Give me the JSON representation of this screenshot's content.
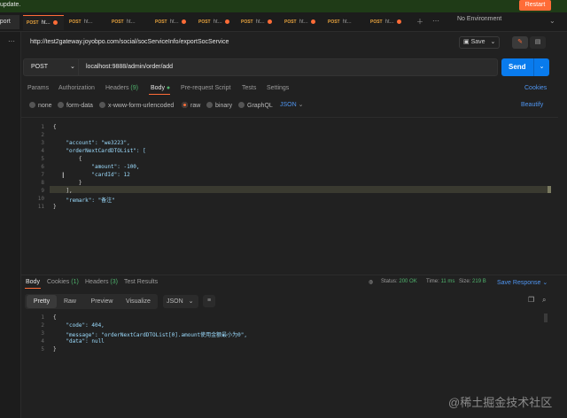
{
  "banner": {
    "text": "update.",
    "restart": "Restart"
  },
  "tabs": [
    {
      "method": "POST",
      "name": "ht...",
      "dot": true
    },
    {
      "method": "POST",
      "name": "ht...",
      "dot": false
    },
    {
      "method": "POST",
      "name": "ht...",
      "dot": false
    },
    {
      "method": "POST",
      "name": "ht...",
      "dot": true
    },
    {
      "method": "POST",
      "name": "ht...",
      "dot": true
    },
    {
      "method": "POST",
      "name": "ht...",
      "dot": true
    },
    {
      "method": "POST",
      "name": "ht...",
      "dot": true
    },
    {
      "method": "POST",
      "name": "ht...",
      "dot": false
    },
    {
      "method": "POST",
      "name": "ht...",
      "dot": true
    }
  ],
  "toolbar": {
    "import": "Import",
    "env": "No Environment"
  },
  "request": {
    "title_url": "http://test2gateway.joyobpo.com/social/socServiceInfo/exportSocService",
    "save": "Save",
    "method": "POST",
    "url": "localhost:9888/admin/order/add",
    "send": "Send"
  },
  "req_tabs": {
    "params": "Params",
    "authorization": "Authorization",
    "headers": "Headers",
    "headers_count": "(9)",
    "body": "Body",
    "pre_request": "Pre-request Script",
    "tests": "Tests",
    "settings": "Settings",
    "cookies": "Cookies"
  },
  "body_opts": {
    "none": "none",
    "form_data": "form-data",
    "urlencoded": "x-www-form-urlencoded",
    "raw": "raw",
    "binary": "binary",
    "graphql": "GraphQL",
    "json": "JSON",
    "beautify": "Beautify"
  },
  "request_lines": [
    "1",
    "2",
    "3",
    "4",
    "5",
    "6",
    "7",
    "8",
    "9",
    "10",
    "11"
  ],
  "request_code": [
    "{",
    "",
    "    \"account\": \"we3223\",",
    "    \"orderNextCardDTOList\": [",
    "        {",
    "            \"amount\": -100,",
    "            \"cardId\": 12",
    "        }",
    "    ],",
    "    \"remark\": \"备注\"",
    "}"
  ],
  "resp_tabs": {
    "body": "Body",
    "cookies": "Cookies",
    "cookies_count": "(1)",
    "headers": "Headers",
    "headers_count": "(3)",
    "test_results": "Test Results"
  },
  "resp_status": {
    "status_label": "Status:",
    "status_value": "200 OK",
    "time_label": "Time:",
    "time_value": "11 ms",
    "size_label": "Size:",
    "size_value": "219 B",
    "save_response": "Save Response"
  },
  "resp_view": {
    "pretty": "Pretty",
    "raw": "Raw",
    "preview": "Preview",
    "visualize": "Visualize",
    "json": "JSON"
  },
  "response_lines": [
    "1",
    "2",
    "3",
    "4",
    "5"
  ],
  "response_code": [
    "{",
    "    \"code\": 404,",
    "    \"message\": \"orderNextCardDTOList[0].amount使用金额最小为0\",",
    "    \"data\": null",
    "}"
  ],
  "watermark": "@稀土掘金技术社区",
  "icons": {
    "new_tab": "plus-icon",
    "more": "ellipsis-icon",
    "env": "chevron-down-icon"
  }
}
